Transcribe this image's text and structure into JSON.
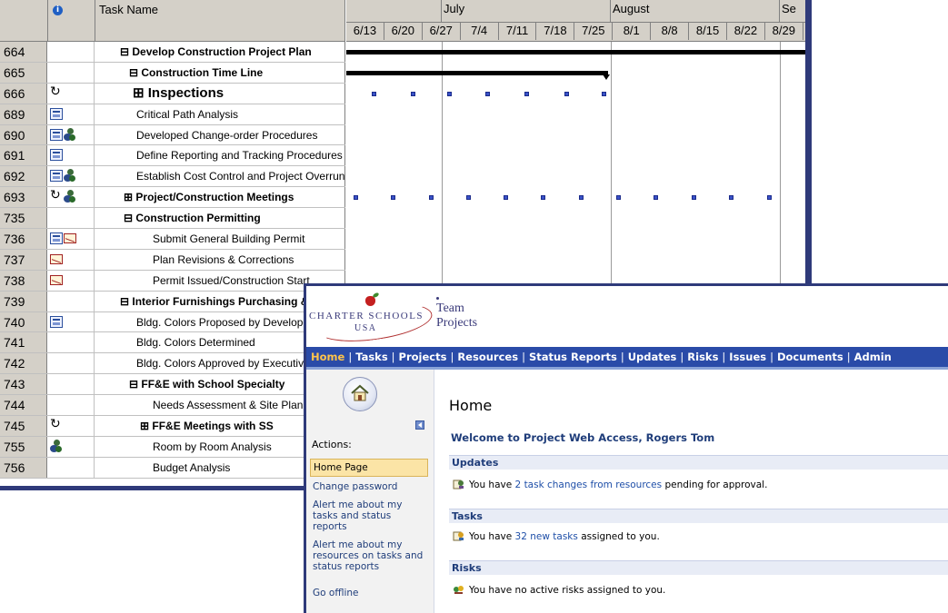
{
  "project_sheet": {
    "columns": {
      "id": "",
      "task_name": "Task Name"
    },
    "timescale": {
      "months": [
        "July",
        "August",
        "Se"
      ],
      "weeks": [
        "6/13",
        "6/20",
        "6/27",
        "7/4",
        "7/11",
        "7/18",
        "7/25",
        "8/1",
        "8/8",
        "8/15",
        "8/22",
        "8/29"
      ]
    },
    "rows": [
      {
        "id": "664",
        "name": "⊟ Develop Construction Project Plan",
        "indicators": []
      },
      {
        "id": "665",
        "name": "⊟ Construction Time Line",
        "indicators": []
      },
      {
        "id": "666",
        "name": "⊞ Inspections",
        "indicators": [
          "recurring-icon"
        ]
      },
      {
        "id": "689",
        "name": "Critical Path Analysis",
        "indicators": [
          "calendar-icon"
        ]
      },
      {
        "id": "690",
        "name": "Developed Change-order Procedures",
        "indicators": [
          "calendar-icon",
          "resource-icon"
        ]
      },
      {
        "id": "691",
        "name": "Define Reporting and Tracking Procedures",
        "indicators": [
          "calendar-icon"
        ]
      },
      {
        "id": "692",
        "name": "Establish Cost Control and Project Overrun",
        "indicators": [
          "calendar-icon",
          "resource-icon"
        ]
      },
      {
        "id": "693",
        "name": "⊞ Project/Construction Meetings",
        "indicators": [
          "recurring-icon",
          "resource-icon"
        ]
      },
      {
        "id": "735",
        "name": "⊟ Construction Permitting",
        "indicators": []
      },
      {
        "id": "736",
        "name": "Submit General Building Permit",
        "indicators": [
          "calendar-icon",
          "mail-icon"
        ]
      },
      {
        "id": "737",
        "name": "Plan Revisions & Corrections",
        "indicators": [
          "mail-icon"
        ]
      },
      {
        "id": "738",
        "name": "Permit Issued/Construction Start",
        "indicators": [
          "mail-icon"
        ]
      },
      {
        "id": "739",
        "name": "⊟ Interior Furnishings Purchasing & Installation",
        "indicators": []
      },
      {
        "id": "740",
        "name": "Bldg. Colors Proposed by Developer",
        "indicators": [
          "calendar-icon"
        ]
      },
      {
        "id": "741",
        "name": "Bldg. Colors Determined",
        "indicators": []
      },
      {
        "id": "742",
        "name": "Bldg. Colors Approved by Executive",
        "indicators": []
      },
      {
        "id": "743",
        "name": "⊟ FF&E with School Specialty",
        "indicators": []
      },
      {
        "id": "744",
        "name": "Needs Assessment & Site Planning",
        "indicators": []
      },
      {
        "id": "745",
        "name": "⊞ FF&E Meetings with SS",
        "indicators": [
          "recurring-icon"
        ]
      },
      {
        "id": "755",
        "name": "Room by Room Analysis",
        "indicators": [
          "resource-icon"
        ]
      },
      {
        "id": "756",
        "name": "Budget Analysis",
        "indicators": []
      }
    ]
  },
  "pwa": {
    "brand": {
      "logo_text": "CHARTER SCHOOLS",
      "logo_sub": "USA",
      "app_title_1": "Team",
      "app_title_2": "Projects"
    },
    "nav": [
      "Home",
      "Tasks",
      "Projects",
      "Resources",
      "Status Reports",
      "Updates",
      "Risks",
      "Issues",
      "Documents",
      "Admin"
    ],
    "nav_active": "Home",
    "sidebar": {
      "home_icon": "home-icon",
      "actions_label": "Actions:",
      "actions": [
        "Home Page",
        "Change password",
        "Alert me about my tasks and status reports",
        "Alert me about my resources on tasks and status reports",
        "Go offline"
      ],
      "selected": "Home Page"
    },
    "main": {
      "title": "Home",
      "welcome": "Welcome to Project Web Access, Rogers Tom",
      "updates": {
        "heading": "Updates",
        "pre": "You have ",
        "link": "2 task changes from resources",
        "post": " pending for approval."
      },
      "tasks": {
        "heading": "Tasks",
        "pre": "You have ",
        "link": "32 new tasks",
        "post": " assigned to you."
      },
      "risks": {
        "heading": "Risks",
        "text": "You have no active risks assigned to you."
      }
    },
    "colors": {
      "navbar": "#2a4ba8",
      "nav_active": "#ffc44a",
      "window_border": "#2f3a7a",
      "selected_action": "#fbe4a6"
    }
  }
}
